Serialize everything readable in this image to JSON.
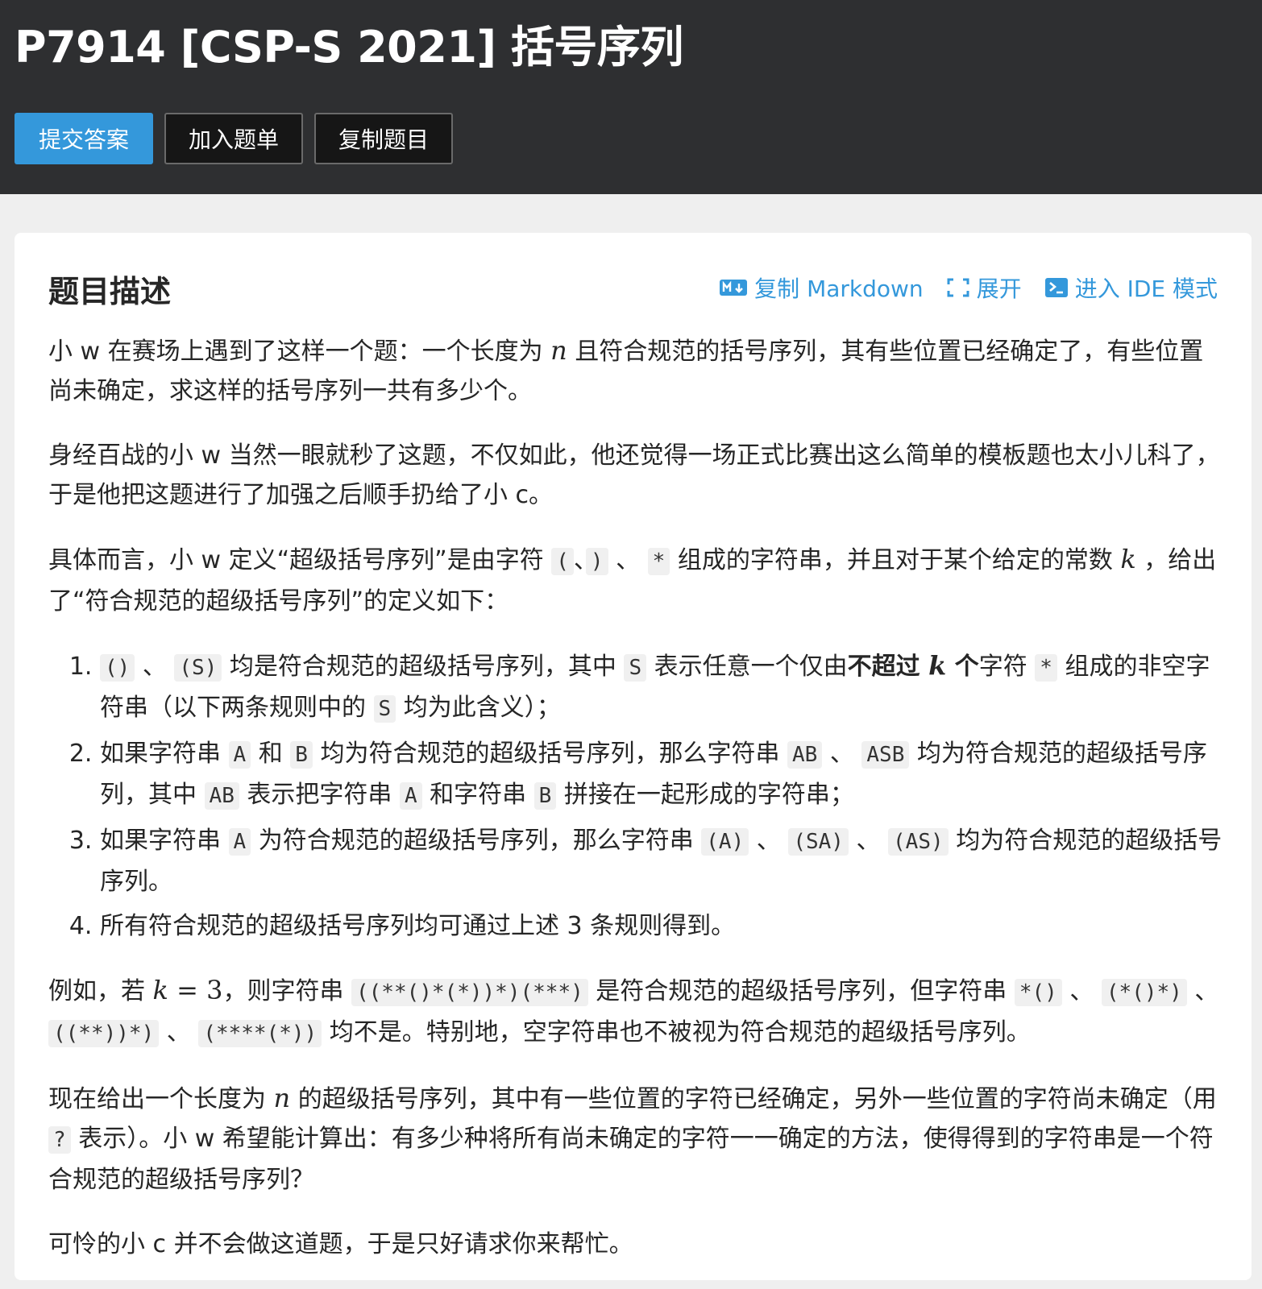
{
  "header": {
    "title": "P7914 [CSP-S 2021] 括号序列",
    "buttons": {
      "submit": "提交答案",
      "add_to_list": "加入题单",
      "copy_problem": "复制题目"
    }
  },
  "card": {
    "section_title": "题目描述",
    "actions": {
      "copy_markdown": "复制 Markdown",
      "expand": "展开",
      "ide_mode": "进入 IDE 模式"
    }
  },
  "colors": {
    "header_bg": "#2e2f31",
    "accent": "#3498db",
    "page_bg": "#efefef"
  },
  "icons": {
    "copy_markdown": "markdown-icon",
    "expand": "expand-icon",
    "ide_mode": "terminal-icon"
  },
  "content": {
    "p1": {
      "a": "小 w 在赛场上遇到了这样一个题：一个长度为 ",
      "n": "n",
      "b": " 且符合规范的括号序列，其有些位置已经确定了，有些位置尚未确定，求这样的括号序列一共有多少个。"
    },
    "p2": "身经百战的小 w 当然一眼就秒了这题，不仅如此，他还觉得一场正式比赛出这么简单的模板题也太小儿科了，于是他把这题进行了加强之后顺手扔给了小 c。",
    "p3": {
      "a": "具体而言，小 w 定义“超级括号序列”是由字符 ",
      "c1": "(",
      "sep1": "、",
      "c2": ")",
      "sep2": " 、 ",
      "c3": "*",
      "b": " 组成的字符串，并且对于某个给定的常数 ",
      "k": "k",
      "c": " ，给出了“符合规范的超级括号序列”的定义如下："
    },
    "rules": {
      "r1": {
        "c1": "()",
        "sep": " 、 ",
        "c2": "(S)",
        "a": " 均是符合规范的超级括号序列，其中 ",
        "c3": "S",
        "b": " 表示任意一个仅由",
        "bold1": "不超过 ",
        "k": "k",
        "bold2": " 个",
        "c": "字符 ",
        "c4": "*",
        "d": " 组成的非空字符串（以下两条规则中的 ",
        "c5": "S",
        "e": " 均为此含义）；"
      },
      "r2": {
        "a": "如果字符串 ",
        "c1": "A",
        "b": " 和 ",
        "c2": "B",
        "c": " 均为符合规范的超级括号序列，那么字符串 ",
        "c3": "AB",
        "sep": " 、 ",
        "c4": "ASB",
        "d": " 均为符合规范的超级括号序列，其中 ",
        "c5": "AB",
        "e": " 表示把字符串 ",
        "c6": "A",
        "f": " 和字符串 ",
        "c7": "B",
        "g": " 拼接在一起形成的字符串；"
      },
      "r3": {
        "a": "如果字符串 ",
        "c1": "A",
        "b": " 为符合规范的超级括号序列，那么字符串 ",
        "c2": "(A)",
        "sep1": " 、 ",
        "c3": "(SA)",
        "sep2": " 、 ",
        "c4": "(AS)",
        "c": " 均为符合规范的超级括号序列。"
      },
      "r4": "所有符合规范的超级括号序列均可通过上述 3 条规则得到。"
    },
    "p4": {
      "a": "例如，若 ",
      "k": "k",
      "eq": " = 3",
      "b": "，则字符串 ",
      "c1": "((**()*(*))*)(***)",
      "c": " 是符合规范的超级括号序列，但字符串 ",
      "c2": "*()",
      "sep1": " 、 ",
      "c3": "(*()*)",
      "sep2": " 、 ",
      "c4": "((**))*)",
      "sep3": " 、 ",
      "c5": "(****(*))",
      "d": " 均不是。特别地，空字符串也不被视为符合规范的超级括号序列。"
    },
    "p5": {
      "a": "现在给出一个长度为 ",
      "n": "n",
      "b": " 的超级括号序列，其中有一些位置的字符已经确定，另外一些位置的字符尚未确定（用 ",
      "c1": "?",
      "c": " 表示）。小 w 希望能计算出：有多少种将所有尚未确定的字符一一确定的方法，使得得到的字符串是一个符合规范的超级括号序列？"
    },
    "p6": "可怜的小 c 并不会做这道题，于是只好请求你来帮忙。"
  }
}
